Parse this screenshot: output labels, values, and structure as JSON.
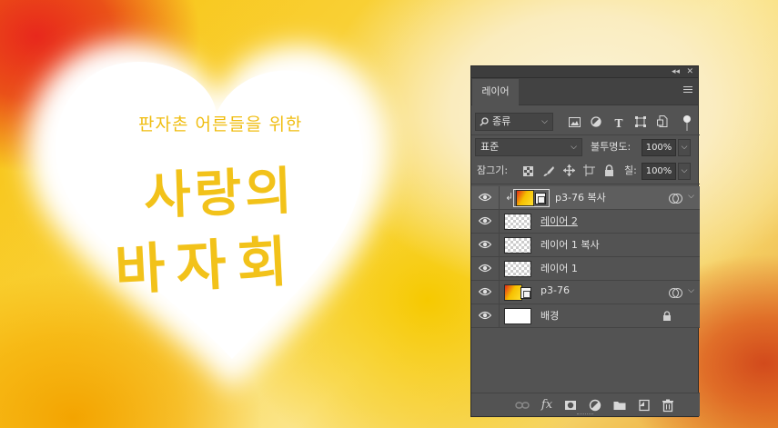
{
  "artwork": {
    "subtitle": "판자촌 어른들을 위한",
    "title_line1": "사랑의",
    "title_line2": "바자회"
  },
  "panel": {
    "tab_label": "레이어",
    "topbar": {
      "collapse_glyph": "◂◂",
      "close_glyph": "✕"
    },
    "filter": {
      "search_icon": "search-icon",
      "kind_value": "종류",
      "icons": [
        "image-filter-icon",
        "adjustment-filter-icon",
        "type-filter-icon",
        "shape-filter-icon",
        "smart-object-filter-icon"
      ]
    },
    "blend": {
      "mode_value": "표준",
      "opacity_label": "불투명도:",
      "opacity_value": "100%"
    },
    "lock": {
      "label": "잠그기:",
      "fill_label": "칠:",
      "fill_value": "100%"
    },
    "layers": [
      {
        "name": "p3-76 복사",
        "kind": "smart",
        "selected": true,
        "clipped": true,
        "effects": true
      },
      {
        "name": "레이어 2",
        "kind": "pixel",
        "underline": true
      },
      {
        "name": "레이어 1 복사",
        "kind": "pixel"
      },
      {
        "name": "레이어 1",
        "kind": "pixel"
      },
      {
        "name": "p3-76",
        "kind": "smart",
        "effects": true
      },
      {
        "name": "배경",
        "kind": "background",
        "locked": true
      }
    ],
    "bottom_icons": [
      "link-layers-icon",
      "fx-icon",
      "add-mask-icon",
      "new-adjustment-icon",
      "new-group-icon",
      "new-layer-icon",
      "delete-layer-icon"
    ],
    "colors": {
      "panel_bg": "#535353",
      "selected_row": "#5e5e5e",
      "tab_bar": "#424242"
    }
  }
}
